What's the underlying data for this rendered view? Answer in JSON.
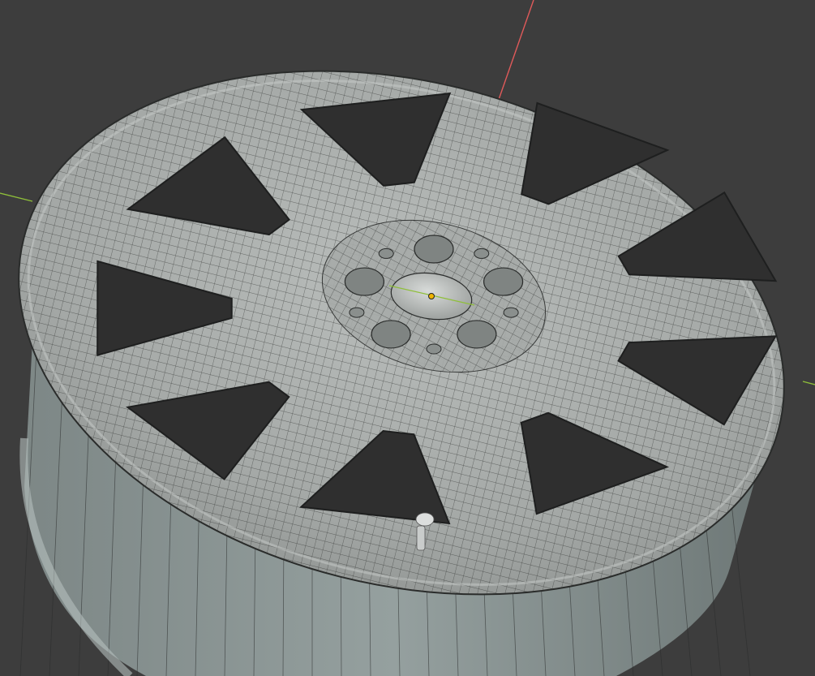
{
  "viewport": {
    "background": "#3d3d3d",
    "mesh_face_color": "#a9adab",
    "mesh_edge_color": "#2a2c2b",
    "barrel_color": "#8d9796",
    "hole_color": "#2f2f2f",
    "axis_x_color": "#e05a5a",
    "axis_y_color": "#8fbf3a",
    "origin_color": "#f0b400"
  },
  "object": {
    "type": "wheel-rim",
    "spoke_count": 9,
    "lug_hole_count": 5,
    "small_hole_count": 5,
    "display_mode": "solid-wireframe"
  }
}
